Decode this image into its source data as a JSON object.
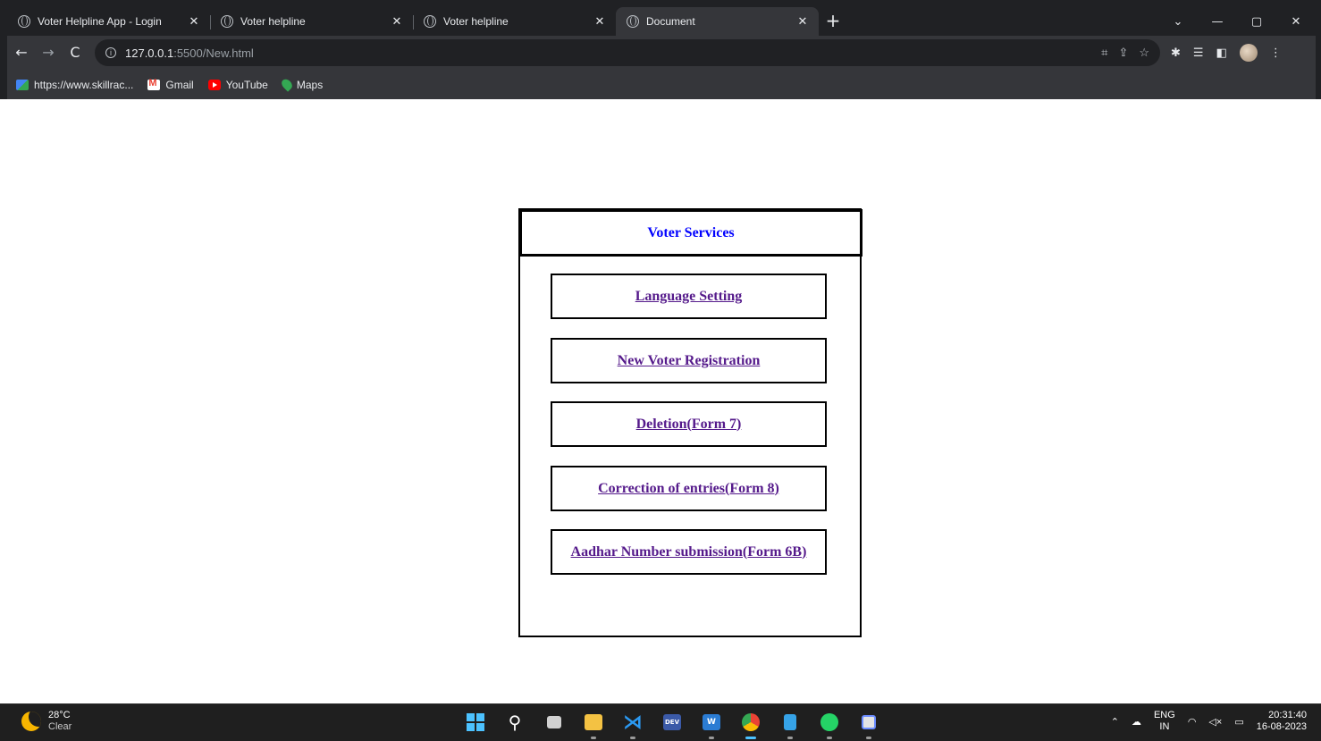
{
  "browser": {
    "tabs": [
      {
        "title": "Voter Helpline App - Login",
        "close": "✕",
        "active": false
      },
      {
        "title": "Voter helpline",
        "close": "✕",
        "active": false
      },
      {
        "title": "Voter helpline",
        "close": "✕",
        "active": false
      },
      {
        "title": "Document",
        "close": "✕",
        "active": true
      }
    ],
    "new_tab": "+",
    "window_controls": {
      "tab_search": "⌄",
      "minimize": "—",
      "maximize": "▢",
      "close": "✕"
    },
    "nav": {
      "back": "←",
      "forward": "→",
      "reload": "C"
    },
    "url_host": "127.0.0.1",
    "url_path": ":5500/New.html",
    "bookmarks": [
      {
        "label": "https://www.skillrac...",
        "icon": "skillrack-icon"
      },
      {
        "label": "Gmail",
        "icon": "gmail-icon"
      },
      {
        "label": "YouTube",
        "icon": "youtube-icon"
      },
      {
        "label": "Maps",
        "icon": "maps-icon"
      }
    ]
  },
  "page": {
    "header": "Voter Services",
    "services": [
      "Language Setting",
      "New Voter Registration",
      "Deletion(Form 7)",
      "Correction of entries(Form 8)",
      "Aadhar Number submission(Form 6B)"
    ]
  },
  "taskbar": {
    "weather_temp": "28°C",
    "weather_desc": "Clear",
    "lang_top": "ENG",
    "lang_bottom": "IN",
    "time": "20:31:40",
    "date": "16-08-2023",
    "accent": "#4cc2ff"
  }
}
